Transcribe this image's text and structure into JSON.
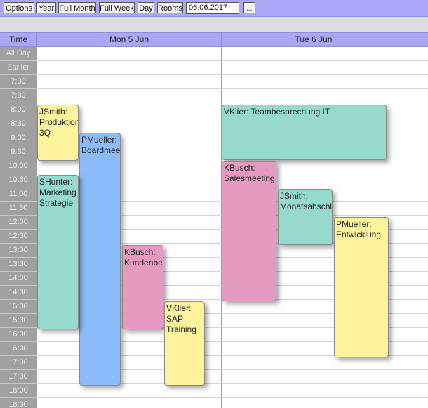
{
  "toolbar": {
    "options": "Options",
    "year": "Year",
    "full_month": "Full Month",
    "full_week": "Full Week",
    "day": "Day",
    "rooms": "Rooms",
    "date_value": "06.06.2017",
    "back_arrow": "←"
  },
  "header": {
    "time": "Time",
    "days": [
      "Mon 5 Jun",
      "Tue 6 Jun"
    ]
  },
  "rows": [
    "All Day",
    "Earlier",
    "7:00",
    "7:30",
    "8:00",
    "8:30",
    "9:00",
    "9:30",
    "10:00",
    "10:30",
    "11:00",
    "11:30",
    "12:00",
    "12:30",
    "13:00",
    "13:30",
    "14:00",
    "14:30",
    "15:00",
    "15:30",
    "16:00",
    "16:30",
    "17:00",
    "17:30",
    "18:00",
    "18:30"
  ],
  "events": [
    {
      "text": "JSmith:\nProduktion\n3Q",
      "color": "#fdf39c"
    },
    {
      "text": "PMueller:\nBoardmeeting",
      "color": "#8bbcf8"
    },
    {
      "text": "SHunter:\nMarketing\nStrategie",
      "color": "#96d9cd"
    },
    {
      "text": "KBusch:\nKundenbesuch",
      "color": "#e69ac0"
    },
    {
      "text": "VKlier:\nSAP\nTraining",
      "color": "#fdf39c"
    },
    {
      "text": "VKlier: Teambesprechung IT",
      "color": "#96d9cd"
    },
    {
      "text": "KBusch:\nSalesmeeting",
      "color": "#e69ac0"
    },
    {
      "text": "JSmith:\nMonatsabschluss",
      "color": "#96d9cd"
    },
    {
      "text": "PMueller:\nEntwicklung",
      "color": "#fdf39c"
    }
  ]
}
